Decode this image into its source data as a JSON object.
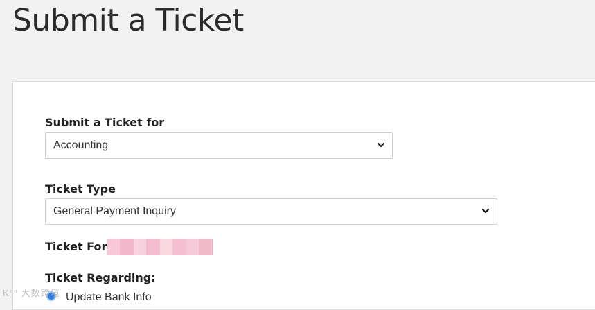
{
  "page": {
    "title": "Submit a Ticket"
  },
  "form": {
    "submit_for": {
      "label": "Submit a Ticket for",
      "value": "Accounting"
    },
    "ticket_type": {
      "label": "Ticket Type",
      "value": "General Payment Inquiry"
    },
    "ticket_for": {
      "label": "Ticket For",
      "value_redacted": true
    },
    "ticket_regarding": {
      "label": "Ticket Regarding:",
      "options": [
        {
          "label": "Update Bank Info",
          "selected": true
        }
      ]
    }
  },
  "watermark": {
    "text": "K°° 大数跨境"
  },
  "colors": {
    "page_bg": "#f2f2f2",
    "card_bg": "#ffffff",
    "radio_accent": "#2d7ce0",
    "redaction": "#f4c4d4"
  },
  "icons": {
    "select_arrow": "chevron-down-icon"
  }
}
